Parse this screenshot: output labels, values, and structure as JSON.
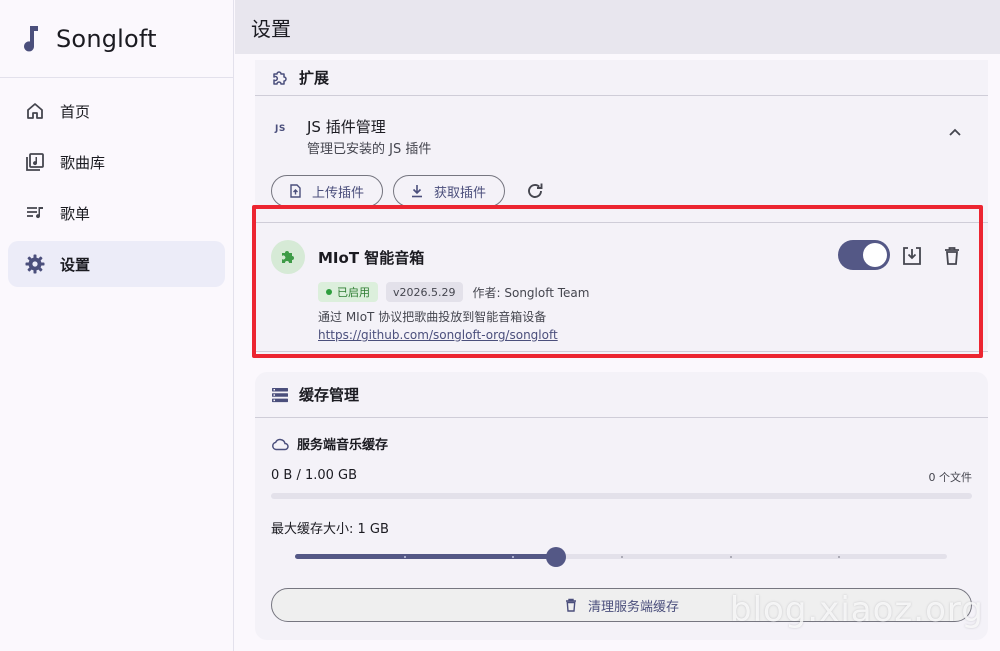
{
  "app": {
    "name": "Songloft"
  },
  "sidebar": {
    "items": [
      {
        "label": "首页",
        "icon": "home-icon",
        "active": false
      },
      {
        "label": "歌曲库",
        "icon": "library-music-icon",
        "active": false
      },
      {
        "label": "歌单",
        "icon": "playlist-icon",
        "active": false
      },
      {
        "label": "设置",
        "icon": "gear-icon",
        "active": true
      }
    ]
  },
  "header": {
    "title": "设置"
  },
  "extensions": {
    "title": "扩展",
    "icon": "puzzle-outline-icon",
    "js": {
      "badge": "JS",
      "title": "JS 插件管理",
      "subtitle": "管理已安装的 JS 插件",
      "expanded": true
    },
    "buttons": {
      "upload": "上传插件",
      "fetch": "获取插件"
    },
    "plugin": {
      "name": "MIoT 智能音箱",
      "status": "已启用",
      "version": "v2026.5.29",
      "author": "作者: Songloft Team",
      "description": "通过 MIoT 协议把歌曲投放到智能音箱设备",
      "url": "https://github.com/songloft-org/songloft",
      "enabled": true
    }
  },
  "cache": {
    "title": "缓存管理",
    "service": {
      "title": "服务端音乐缓存",
      "usage": "0 B / 1.00 GB",
      "file_count": "0 个文件",
      "usage_fraction": 0
    },
    "max_size": {
      "label": "最大缓存大小: 1 GB",
      "value_fraction": 0.4,
      "steps": 6
    },
    "clear_button": "清理服务端缓存"
  },
  "watermark": "blog.xiaoz.org",
  "colors": {
    "accent": "#545886",
    "highlight": "#ec2531",
    "enabled_green": "#2e7d32"
  }
}
